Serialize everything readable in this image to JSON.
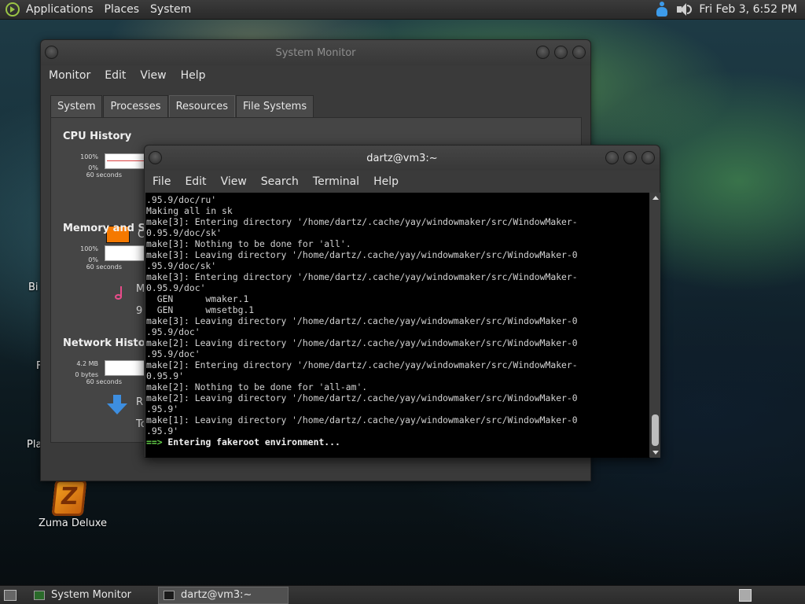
{
  "top_panel": {
    "menus": [
      "Applications",
      "Places",
      "System"
    ],
    "clock": "Fri Feb  3,  6:52 PM"
  },
  "desktop": {
    "icons": [
      {
        "label": "Bi"
      },
      {
        "label": "F"
      },
      {
        "label": "Pla"
      },
      {
        "label": "Zuma Deluxe"
      }
    ]
  },
  "system_monitor": {
    "title": "System Monitor",
    "menu": [
      "Monitor",
      "Edit",
      "View",
      "Help"
    ],
    "tabs": [
      "System",
      "Processes",
      "Resources",
      "File Systems"
    ],
    "active_tab": "Resources",
    "cpu": {
      "title": "CPU History",
      "y_max": "100%",
      "y_min": "0%",
      "span": "60 seconds",
      "legend_partial": "C",
      "swatch_color": "#f57900"
    },
    "memory": {
      "title": "Memory and Swa",
      "y_max": "100%",
      "y_min": "0%",
      "span": "60 seconds",
      "legend_partial": "M",
      "value_partial": "9"
    },
    "network": {
      "title": "Network History",
      "y_max": "4.2 MB",
      "y_min": "0 bytes",
      "span": "60 seconds",
      "receiving_partial": "R",
      "total_partial": "To"
    }
  },
  "terminal": {
    "title": "dartz@vm3:~",
    "menu": [
      "File",
      "Edit",
      "View",
      "Search",
      "Terminal",
      "Help"
    ],
    "lines": [
      ".95.9/doc/ru'",
      "Making all in sk",
      "make[3]: Entering directory '/home/dartz/.cache/yay/windowmaker/src/WindowMaker-",
      "0.95.9/doc/sk'",
      "make[3]: Nothing to be done for 'all'.",
      "make[3]: Leaving directory '/home/dartz/.cache/yay/windowmaker/src/WindowMaker-0",
      ".95.9/doc/sk'",
      "make[3]: Entering directory '/home/dartz/.cache/yay/windowmaker/src/WindowMaker-",
      "0.95.9/doc'",
      "  GEN      wmaker.1",
      "  GEN      wmsetbg.1",
      "make[3]: Leaving directory '/home/dartz/.cache/yay/windowmaker/src/WindowMaker-0",
      ".95.9/doc'",
      "make[2]: Leaving directory '/home/dartz/.cache/yay/windowmaker/src/WindowMaker-0",
      ".95.9/doc'",
      "make[2]: Entering directory '/home/dartz/.cache/yay/windowmaker/src/WindowMaker-",
      "0.95.9'",
      "make[2]: Nothing to be done for 'all-am'.",
      "make[2]: Leaving directory '/home/dartz/.cache/yay/windowmaker/src/WindowMaker-0",
      ".95.9'",
      "make[1]: Leaving directory '/home/dartz/.cache/yay/windowmaker/src/WindowMaker-0",
      ".95.9'"
    ],
    "prompt_arrow": "==>",
    "prompt_text": " Entering fakeroot environment..."
  },
  "bottom_panel": {
    "tasks": [
      "System Monitor",
      "dartz@vm3:~"
    ]
  }
}
